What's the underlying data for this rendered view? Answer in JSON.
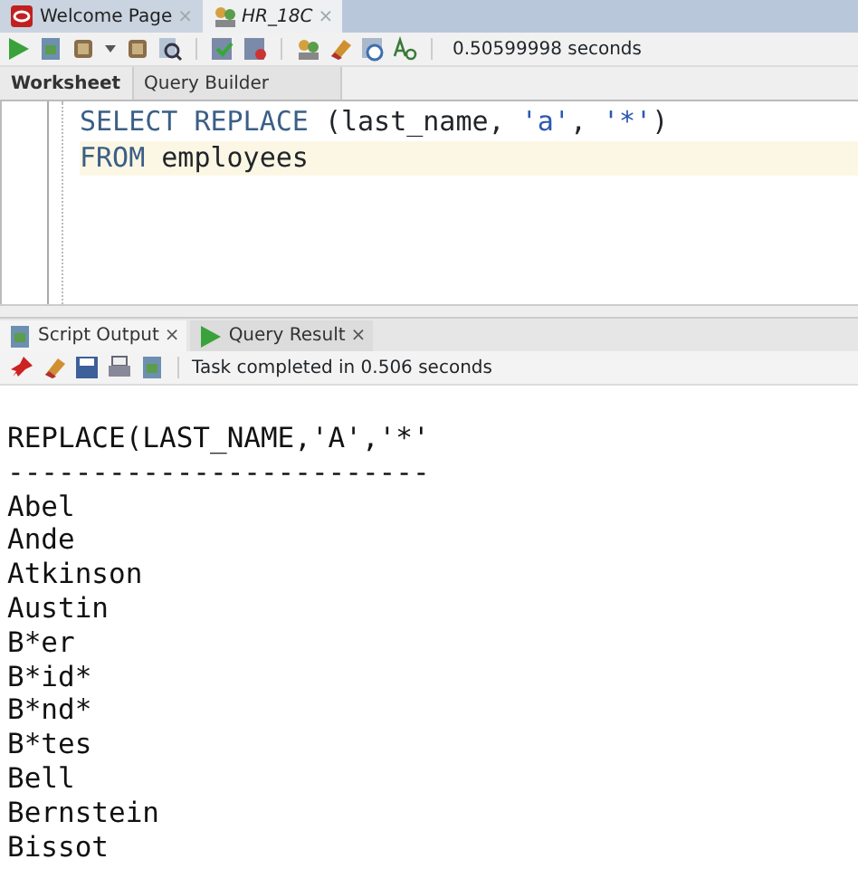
{
  "document_tabs": [
    {
      "label": "Welcome Page",
      "selected": false,
      "close": "×"
    },
    {
      "label": "HR_18C",
      "selected": true,
      "close": "×"
    }
  ],
  "toolbar": {
    "timing": "0.50599998 seconds"
  },
  "editor_tabs": [
    {
      "label": "Worksheet",
      "selected": true
    },
    {
      "label": "Query Builder",
      "selected": false
    }
  ],
  "editor_lines": [
    {
      "current": false,
      "tokens": [
        {
          "kind": "keyword",
          "text": "SELECT REPLACE"
        },
        {
          "kind": "plain",
          "text": " (last_name, "
        },
        {
          "kind": "string",
          "text": "'a'"
        },
        {
          "kind": "plain",
          "text": ", "
        },
        {
          "kind": "string",
          "text": "'*'"
        },
        {
          "kind": "plain",
          "text": ")"
        }
      ]
    },
    {
      "current": true,
      "tokens": [
        {
          "kind": "keyword",
          "text": "FROM"
        },
        {
          "kind": "plain",
          "text": " employees"
        }
      ]
    }
  ],
  "output_tabs": [
    {
      "label": "Script Output",
      "selected": true,
      "close": "×"
    },
    {
      "label": "Query Result",
      "selected": false,
      "close": "×"
    }
  ],
  "output_toolbar": {
    "status": "Task completed in 0.506 seconds"
  },
  "output": {
    "header": "REPLACE(LAST_NAME,'A','*'",
    "rule": "-------------------------",
    "rows": [
      "Abel",
      "Ande",
      "Atkinson",
      "Austin",
      "B*er",
      "B*id*",
      "B*nd*",
      "B*tes",
      "Bell",
      "Bernstein",
      "Bissot"
    ]
  }
}
